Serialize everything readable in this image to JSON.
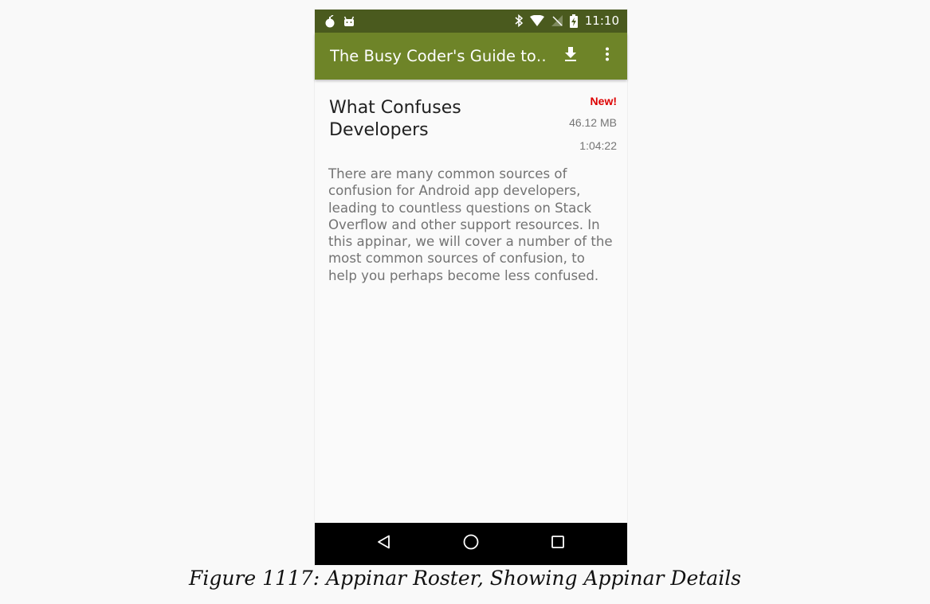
{
  "status_bar": {
    "time": "11:10",
    "left_icons": [
      "bomb-icon",
      "android-icon"
    ],
    "right_icons": [
      "bluetooth-icon",
      "wifi-icon",
      "no-signal-icon",
      "battery-charging-icon"
    ]
  },
  "app_bar": {
    "title": "The Busy Coder's Guide to…",
    "actions": [
      "download-icon",
      "more-vert-icon"
    ],
    "color": "#6e8428",
    "status_color": "#4a5a1e"
  },
  "item": {
    "title": "What Confuses Developers",
    "badge": "New!",
    "badge_color": "#dd0000",
    "size": "46.12 MB",
    "duration": "1:04:22",
    "description": "There are many common sources of confusion for Android app developers, leading to countless questions on Stack Overflow and other support resources. In this appinar, we will cover a number of the most common sources of confusion, to help you perhaps become less confused."
  },
  "nav_bar": {
    "buttons": [
      "back-icon",
      "home-icon",
      "recents-icon"
    ]
  },
  "caption": "Figure 1117: Appinar Roster, Showing Appinar Details"
}
